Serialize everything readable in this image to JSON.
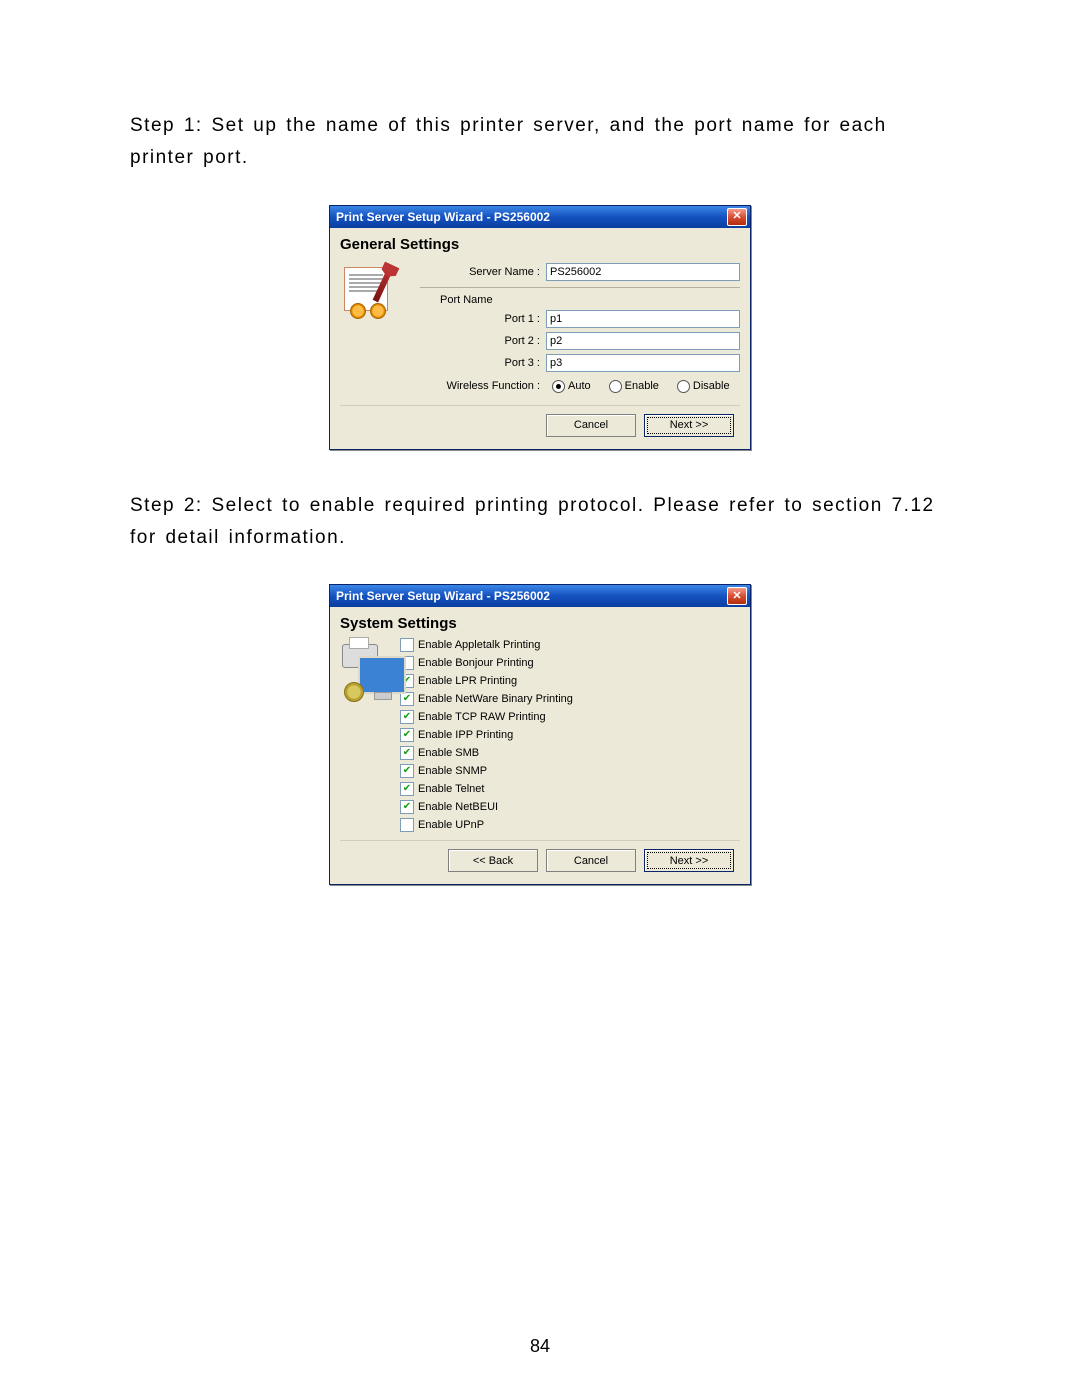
{
  "page_number": "84",
  "step1_text": "Step 1: Set up the name of this printer server, and the port name for each printer port.",
  "step2_text": "Step 2: Select to enable required printing protocol. Please refer to section 7.12 for detail information.",
  "dialog1": {
    "title": "Print Server Setup Wizard - PS256002",
    "section": "General Settings",
    "server_name_label": "Server Name :",
    "server_name_value": "PS256002",
    "port_name_heading": "Port Name",
    "ports": [
      {
        "label": "Port 1 :",
        "value": "p1"
      },
      {
        "label": "Port 2 :",
        "value": "p2"
      },
      {
        "label": "Port 3 :",
        "value": "p3"
      }
    ],
    "wireless_label": "Wireless Function :",
    "wireless_options": [
      {
        "label": "Auto",
        "selected": true
      },
      {
        "label": "Enable",
        "selected": false
      },
      {
        "label": "Disable",
        "selected": false
      }
    ],
    "buttons": {
      "cancel": "Cancel",
      "next": "Next >>"
    }
  },
  "dialog2": {
    "title": "Print Server Setup Wizard - PS256002",
    "section": "System Settings",
    "protocols": [
      {
        "label": "Enable Appletalk Printing",
        "checked": false
      },
      {
        "label": "Enable Bonjour Printing",
        "checked": false
      },
      {
        "label": "Enable LPR Printing",
        "checked": true
      },
      {
        "label": "Enable NetWare Binary Printing",
        "checked": true
      },
      {
        "label": "Enable TCP RAW Printing",
        "checked": true
      },
      {
        "label": "Enable IPP Printing",
        "checked": true
      },
      {
        "label": "Enable SMB",
        "checked": true
      },
      {
        "label": "Enable SNMP",
        "checked": true
      },
      {
        "label": "Enable Telnet",
        "checked": true
      },
      {
        "label": "Enable NetBEUI",
        "checked": true
      },
      {
        "label": "Enable UPnP",
        "checked": false
      }
    ],
    "buttons": {
      "back": "<< Back",
      "cancel": "Cancel",
      "next": "Next >>"
    }
  }
}
